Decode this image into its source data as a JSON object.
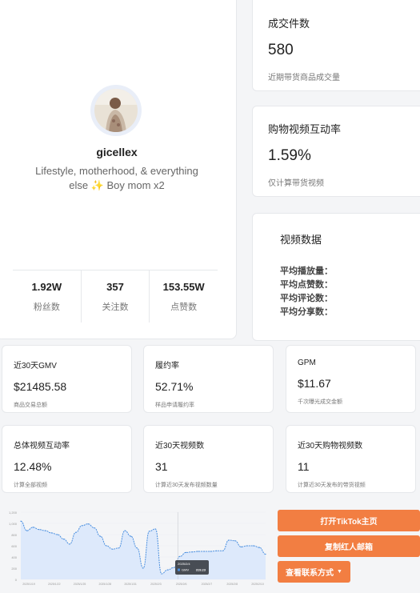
{
  "profile": {
    "username": "gicellex",
    "bio": "Lifestyle, motherhood, & everything else ✨ Boy mom x2",
    "stats": [
      {
        "value": "1.92W",
        "label": "粉丝数"
      },
      {
        "value": "357",
        "label": "关注数"
      },
      {
        "value": "153.55W",
        "label": "点赞数"
      }
    ]
  },
  "right_cards": [
    {
      "title": "成交件数",
      "value": "580",
      "sub": "近期带货商品成交量"
    },
    {
      "title": "购物视频互动率",
      "value": "1.59%",
      "sub": "仅计算带货视频"
    }
  ],
  "video_data": {
    "title": "视频数据",
    "rows": [
      "平均播放量：",
      "平均点赞数：",
      "平均评论数：",
      "平均分享数："
    ]
  },
  "metrics": [
    {
      "title": "近30天GMV",
      "value": "$21485.58",
      "sub": "商品交易总额"
    },
    {
      "title": "履约率",
      "value": "52.71%",
      "sub": "样品申请履约率"
    },
    {
      "title": "GPM",
      "value": "$11.67",
      "sub": "千次曝光成交金额"
    },
    {
      "title": "总体视频互动率",
      "value": "12.48%",
      "sub": "计算全部视频"
    },
    {
      "title": "近30天视频数",
      "value": "31",
      "sub": "计算近30天发布视频数量"
    },
    {
      "title": "近30天购物视频数",
      "value": "11",
      "sub": "计算近30天发布的带货视频"
    }
  ],
  "buttons": {
    "open_tiktok": "打开TikTok主页",
    "copy_email": "复制红人邮箱",
    "contact": "查看联系方式"
  },
  "chart_data": {
    "type": "area",
    "y_ticks": [
      "0",
      "200",
      "400",
      "600",
      "800",
      "1,000",
      "1,200"
    ],
    "ylim": [
      0,
      1200
    ],
    "x_ticks": [
      "2025/1/19",
      "2025/1/22",
      "2025/1/25",
      "2025/1/28",
      "2025/1/31",
      "2025/2/3",
      "2025/2/6",
      "2025/2/7",
      "2025/2/8",
      "2025/2/10"
    ],
    "x": [
      0,
      1,
      2,
      3,
      4,
      5,
      6,
      7,
      8,
      9,
      10,
      11,
      12,
      13,
      14,
      15,
      16,
      17,
      18,
      19,
      20,
      21,
      22,
      23,
      24,
      25,
      26,
      27,
      28,
      29,
      30,
      31,
      32,
      33,
      34,
      35,
      36,
      37,
      38,
      39,
      40
    ],
    "values": [
      1040,
      870,
      930,
      890,
      870,
      830,
      800,
      720,
      630,
      840,
      960,
      990,
      920,
      770,
      600,
      540,
      560,
      870,
      770,
      560,
      200,
      860,
      900,
      100,
      170,
      210,
      410,
      480,
      490,
      500,
      500,
      500,
      510,
      510,
      700,
      690,
      580,
      600,
      600,
      570,
      450
    ],
    "series": [
      {
        "name": "GMV"
      }
    ],
    "tooltip": {
      "date": "2025/2/4",
      "label": "GMV",
      "value": "319.23"
    },
    "colors": {
      "line": "#4a8fe0",
      "fill": "#dde9fb",
      "accent": "#f27e42"
    }
  }
}
